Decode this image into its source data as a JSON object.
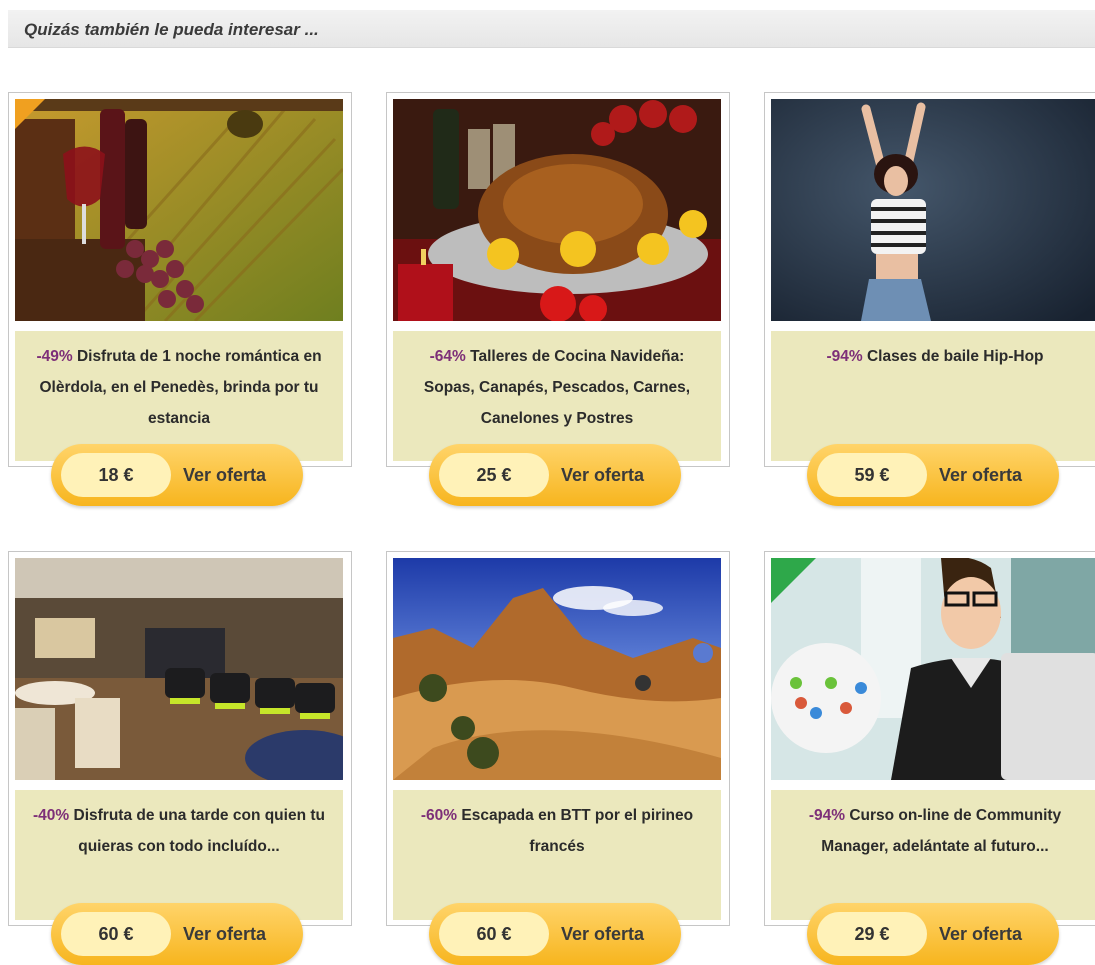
{
  "section": {
    "title": "Quizás también le pueda interesar ..."
  },
  "offers": [
    {
      "discount": "-49%",
      "text": "Disfruta de 1 noche romántica en Olèrdola, en el Penedès, brinda por tu estancia",
      "price": "18 €",
      "cta": "Ver oferta",
      "image": "wine-vineyard-photo"
    },
    {
      "discount": "-64%",
      "text": "Talleres de Cocina Navideña: Sopas, Canapés, Pescados, Carnes, Canelones y Postres",
      "price": "25 €",
      "cta": "Ver oferta",
      "image": "roast-turkey-photo"
    },
    {
      "discount": "-94%",
      "text": "Clases de baile Hip-Hop",
      "price": "59 €",
      "cta": "Ver oferta",
      "image": "hiphop-dancer-photo"
    },
    {
      "discount": "-40%",
      "text": "Disfruta de una tarde con quien tu quieras con todo incluído...",
      "price": "60 €",
      "cta": "Ver oferta",
      "image": "lounge-interior-photo"
    },
    {
      "discount": "-60%",
      "text": "Escapada en BTT por el pirineo francés",
      "price": "60 €",
      "cta": "Ver oferta",
      "image": "desert-biking-photo"
    },
    {
      "discount": "-94%",
      "text": "Curso on-line de Community Manager, adelántate al futuro...",
      "price": "29 €",
      "cta": "Ver oferta",
      "image": "community-manager-photo"
    }
  ],
  "colors": {
    "discount": "#7d2f78",
    "desc_bg": "#ebe8bd",
    "badge": "#f7b51e"
  }
}
